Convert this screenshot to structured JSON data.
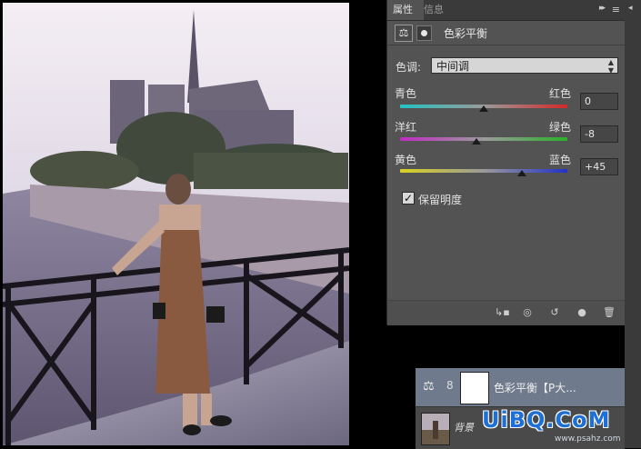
{
  "panel": {
    "tabs": [
      {
        "label": "属性",
        "active": true
      },
      {
        "label": "信息",
        "active": false
      }
    ],
    "menu_glyph": "▸▸",
    "menu_icon": "≡",
    "header": {
      "adjustment_icon": "balance-scale-icon",
      "mask_icon": "layer-mask-icon",
      "title": "色彩平衡"
    },
    "tone": {
      "label": "色调:",
      "value": "中间调",
      "options_visible": [
        "中间调"
      ]
    },
    "sliders": [
      {
        "left_label": "青色",
        "right_label": "红色",
        "value": "0",
        "level": 0,
        "gradient": [
          "#21c3c3",
          "#9a9a9a",
          "#d22a2a"
        ]
      },
      {
        "left_label": "洋红",
        "right_label": "绿色",
        "value": "-8",
        "level": -8,
        "gradient": [
          "#c12ac4",
          "#9a9a9a",
          "#2bb02b"
        ]
      },
      {
        "left_label": "黄色",
        "right_label": "蓝色",
        "value": "+45",
        "level": 45,
        "gradient": [
          "#d8d21f",
          "#9a9a9a",
          "#2430c8"
        ]
      }
    ],
    "preserve_luminosity": {
      "label": "保留明度",
      "checked": true,
      "check_glyph": "✓"
    },
    "bottom_icons": [
      "clip-to-layer-icon",
      "view-previous-icon",
      "reset-icon",
      "visibility-icon",
      "delete-icon"
    ]
  },
  "layers": {
    "items": [
      {
        "name": "色彩平衡【P大...",
        "type": "adjustment",
        "selected": true,
        "link_glyph": "8"
      },
      {
        "name": "背景",
        "type": "image",
        "selected": false
      }
    ]
  },
  "watermark": {
    "text": "UiBQ.CoM",
    "sub": "www.psahz.com"
  },
  "colors": {
    "panel_bg": "#535353",
    "tab_bar": "#3a3a3a",
    "selected_layer": "#6f7a8c",
    "watermark_blue": "#1e6fd6"
  }
}
